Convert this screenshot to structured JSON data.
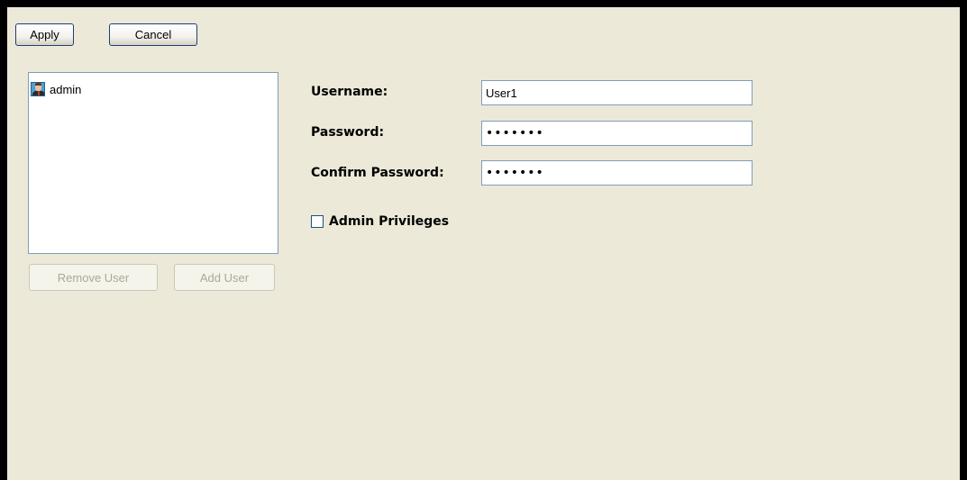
{
  "toolbar": {
    "apply_label": "Apply",
    "cancel_label": "Cancel"
  },
  "users": {
    "items": [
      {
        "label": "admin",
        "icon": "user-avatar-icon"
      }
    ],
    "remove_label": "Remove User",
    "add_label": "Add User"
  },
  "form": {
    "username_label": "Username:",
    "username_value": "User1",
    "password_label": "Password:",
    "password_value": "•••••••",
    "confirm_label": "Confirm Password:",
    "confirm_value": "•••••••",
    "admin_label": "Admin Privileges",
    "admin_checked": false
  },
  "colors": {
    "panel_background": "#ece9d8",
    "border_blue": "#7f9db9",
    "disabled_text": "#aca899"
  }
}
